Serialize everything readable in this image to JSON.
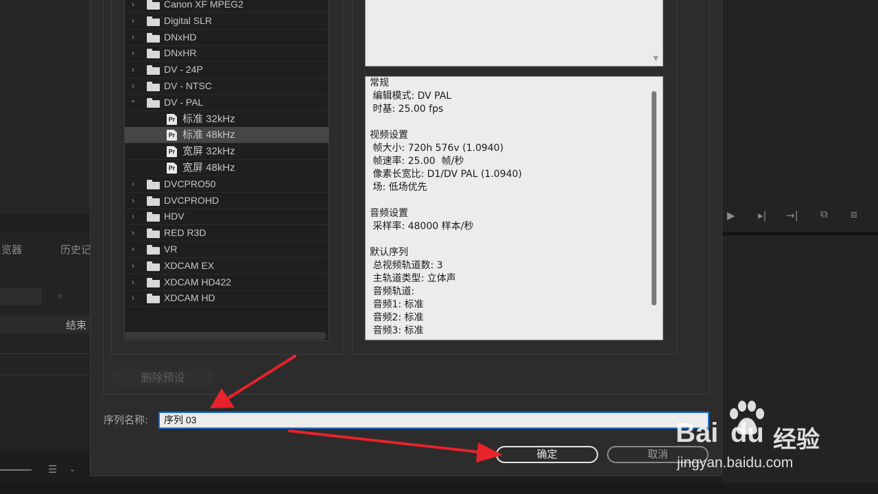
{
  "background": {
    "tab_browser": "览器",
    "tab_history": "历史记",
    "col_end": "结束"
  },
  "tree": {
    "items": [
      {
        "label": "Canon XF MPEG2",
        "type": "folder",
        "expanded": false
      },
      {
        "label": "Digital SLR",
        "type": "folder",
        "expanded": false
      },
      {
        "label": "DNxHD",
        "type": "folder",
        "expanded": false
      },
      {
        "label": "DNxHR",
        "type": "folder",
        "expanded": false
      },
      {
        "label": "DV - 24P",
        "type": "folder",
        "expanded": false
      },
      {
        "label": "DV - NTSC",
        "type": "folder",
        "expanded": false
      },
      {
        "label": "DV - PAL",
        "type": "folder",
        "expanded": true
      },
      {
        "label": "标准 32kHz",
        "type": "preset"
      },
      {
        "label": "标准 48kHz",
        "type": "preset",
        "selected": true
      },
      {
        "label": "宽屏 32kHz",
        "type": "preset"
      },
      {
        "label": "宽屏 48kHz",
        "type": "preset"
      },
      {
        "label": "DVCPRO50",
        "type": "folder",
        "expanded": false
      },
      {
        "label": "DVCPROHD",
        "type": "folder",
        "expanded": false
      },
      {
        "label": "HDV",
        "type": "folder",
        "expanded": false
      },
      {
        "label": "RED R3D",
        "type": "folder",
        "expanded": false
      },
      {
        "label": "VR",
        "type": "folder",
        "expanded": false
      },
      {
        "label": "XDCAM EX",
        "type": "folder",
        "expanded": false
      },
      {
        "label": "XDCAM HD422",
        "type": "folder",
        "expanded": false
      },
      {
        "label": "XDCAM HD",
        "type": "folder",
        "expanded": false
      }
    ]
  },
  "details": {
    "lines": [
      "常规",
      " 编辑模式: DV PAL",
      " 时基: 25.00 fps",
      "",
      "视频设置",
      " 帧大小: 720h 576v (1.0940)",
      " 帧速率: 25.00  帧/秒",
      " 像素长宽比: D1/DV PAL (1.0940)",
      " 场: 低场优先",
      "",
      "音频设置",
      " 采样率: 48000 样本/秒",
      "",
      "默认序列",
      " 总视频轨道数: 3",
      " 主轨道类型: 立体声",
      " 音频轨道:",
      " 音频1: 标准",
      " 音频2: 标准",
      " 音频3: 标准"
    ]
  },
  "buttons": {
    "delete_preset": "删除预设",
    "ok": "确定",
    "cancel": "取消"
  },
  "sequence_name": {
    "label": "序列名称:",
    "value": "序列 03"
  },
  "watermark": {
    "brand_left": "Bai",
    "brand_right": "du",
    "brand_cn": "经验",
    "url": "jingyan.baidu.com"
  },
  "colors": {
    "accent": "#1f6fcf",
    "annotation_arrow": "#e8222a"
  },
  "icons": {
    "folder": "folder-icon",
    "preset": "premiere-preset-icon",
    "expand": "chevron-right-icon",
    "collapse": "chevron-down-icon"
  }
}
